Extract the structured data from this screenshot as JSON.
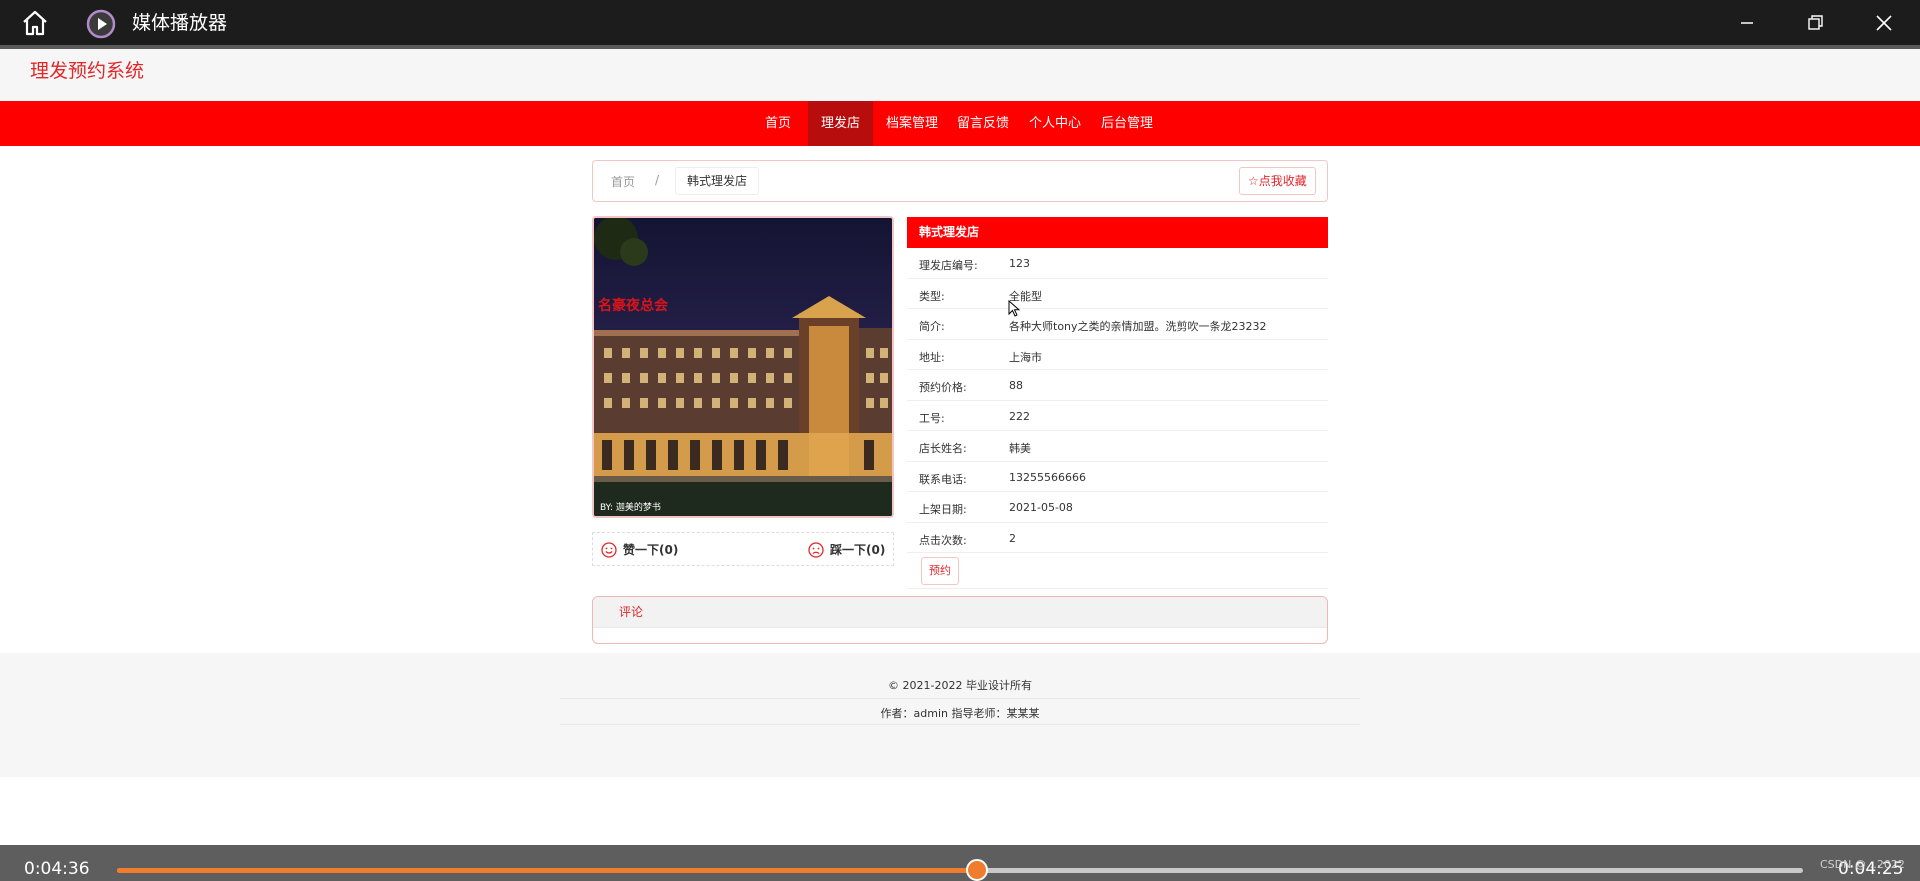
{
  "player": {
    "app_title": "媒体播放器",
    "time_current": "0:04:36",
    "time_remaining": "0:04:25",
    "progress": 0.51,
    "accent": "#f07d2d"
  },
  "site": {
    "title": "理发预约系统",
    "brand_color": "#fe0000"
  },
  "nav": {
    "items": [
      {
        "label": "首页"
      },
      {
        "label": "理发店"
      },
      {
        "label": "档案管理"
      },
      {
        "label": "留言反馈"
      },
      {
        "label": "个人中心"
      },
      {
        "label": "后台管理"
      }
    ],
    "active_index": 1
  },
  "breadcrumb": {
    "home": "首页",
    "separator": "/",
    "current": "韩式理发店",
    "favorite": "☆点我收藏"
  },
  "image": {
    "caption": "BY: 迦美的梦书",
    "sign_text": "名豪夜总会"
  },
  "votes": {
    "up": "赞一下(0)",
    "down": "踩一下(0)"
  },
  "shop": {
    "name": "韩式理发店",
    "fields": [
      {
        "label": "理发店编号:",
        "value": "123"
      },
      {
        "label": "类型:",
        "value": "全能型"
      },
      {
        "label": "简介:",
        "value": "各种大师tony之类的亲情加盟。洗剪吹一条龙23232"
      },
      {
        "label": "地址:",
        "value": "上海市"
      },
      {
        "label": "预约价格:",
        "value": "88"
      },
      {
        "label": "工号:",
        "value": "222"
      },
      {
        "label": "店长姓名:",
        "value": "韩美"
      },
      {
        "label": "联系电话:",
        "value": "13255566666"
      },
      {
        "label": "上架日期:",
        "value": "2021-05-08"
      },
      {
        "label": "点击次数:",
        "value": "2"
      }
    ],
    "book_button": "预约"
  },
  "comments": {
    "title": "评论"
  },
  "footer": {
    "copyright": "© 2021-2022 毕业设计所有",
    "author": "作者：admin 指导老师：某某某"
  },
  "watermark": "CSDN @…2022"
}
